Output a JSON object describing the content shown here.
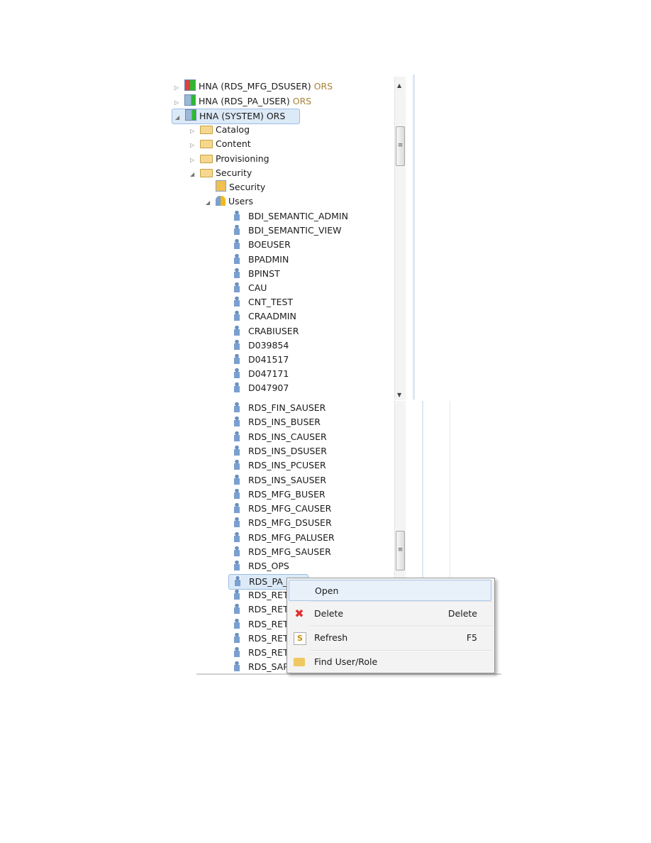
{
  "tree_top": {
    "connections": [
      {
        "label": "HNA (RDS_MFG_DSUSER)",
        "suffix": "ORS",
        "icon": "system-error-icon"
      },
      {
        "label": "HNA (RDS_PA_USER)",
        "suffix": "ORS",
        "icon": "system-icon"
      },
      {
        "label": "HNA (SYSTEM) ORS",
        "suffix": "",
        "icon": "system-icon"
      }
    ],
    "folders": [
      "Catalog",
      "Content",
      "Provisioning",
      "Security"
    ],
    "security_children": [
      "Security",
      "Users"
    ],
    "users": [
      "BDI_SEMANTIC_ADMIN",
      "BDI_SEMANTIC_VIEW",
      "BOEUSER",
      "BPADMIN",
      "BPINST",
      "CAU",
      "CNT_TEST",
      "CRAADMIN",
      "CRABIUSER",
      "D039854",
      "D041517",
      "D047171",
      "D047907"
    ]
  },
  "tree_bottom": {
    "users": [
      "RDS_FIN_SAUSER",
      "RDS_INS_BUSER",
      "RDS_INS_CAUSER",
      "RDS_INS_DSUSER",
      "RDS_INS_PCUSER",
      "RDS_INS_SAUSER",
      "RDS_MFG_BUSER",
      "RDS_MFG_CAUSER",
      "RDS_MFG_DSUSER",
      "RDS_MFG_PALUSER",
      "RDS_MFG_SAUSER",
      "RDS_OPS",
      "RDS_PA_U",
      "RDS_RET_",
      "RDS_RET_",
      "RDS_RET_",
      "RDS_RET_",
      "RDS_RET_",
      "RDS_SAP"
    ],
    "selected": "RDS_PA_U"
  },
  "context_menu": {
    "items": [
      {
        "label": "Open",
        "shortcut": "",
        "icon": ""
      },
      {
        "label": "Delete",
        "shortcut": "Delete",
        "icon": "delete-x-icon"
      },
      {
        "label": "Refresh",
        "shortcut": "F5",
        "icon": "refresh-icon"
      },
      {
        "label": "Find User/Role",
        "shortcut": "",
        "icon": "find-folder-icon"
      }
    ]
  },
  "colors": {
    "ors": "#a8823a",
    "selection": "#dce9f7",
    "delete": "#e03030"
  }
}
